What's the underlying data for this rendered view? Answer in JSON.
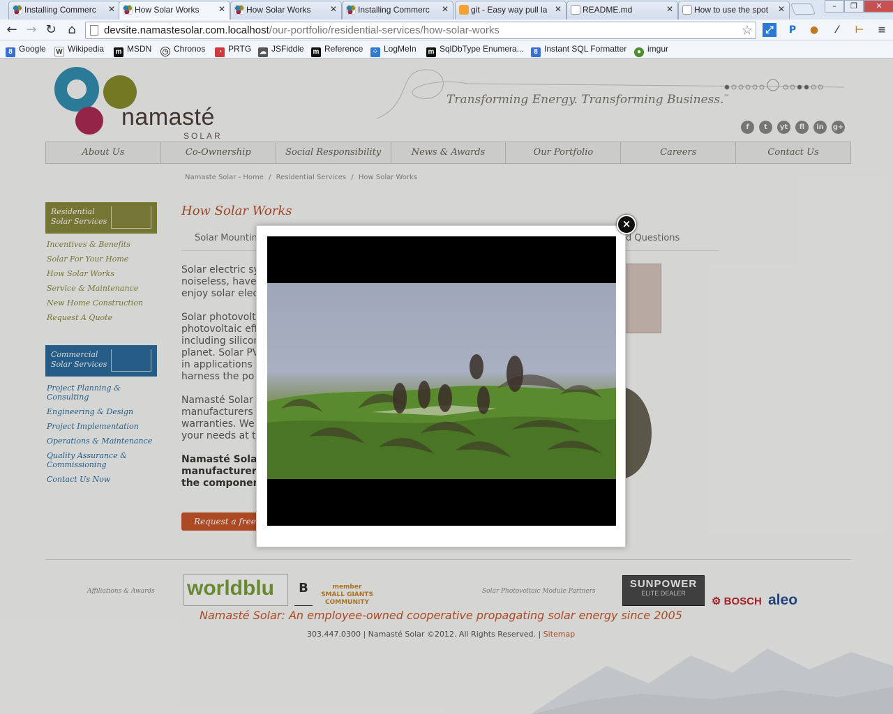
{
  "browser": {
    "tabs": [
      {
        "title": "Installing Commerc",
        "favicon": "namaste-icon",
        "active": false
      },
      {
        "title": "How Solar Works",
        "favicon": "namaste-icon",
        "active": true
      },
      {
        "title": "How Solar Works",
        "favicon": "namaste-icon",
        "active": false
      },
      {
        "title": "Installing Commerc",
        "favicon": "namaste-icon",
        "active": false
      },
      {
        "title": "git - Easy way pull la",
        "favicon": "stackoverflow-icon",
        "active": false
      },
      {
        "title": "README.md",
        "favicon": "document-icon",
        "active": false
      },
      {
        "title": "How to use the spot",
        "favicon": "document-icon",
        "active": false
      }
    ],
    "address": {
      "host": "devsite.namastesolar.com.localhost",
      "path": "/our-portfolio/residential-services/how-solar-works"
    },
    "bookmarks": [
      {
        "label": "Google",
        "icon": "google-icon",
        "color": "#3a6fd8"
      },
      {
        "label": "Wikipedia",
        "icon": "wikipedia-icon",
        "color": "#333333"
      },
      {
        "label": "MSDN",
        "icon": "msdn-icon",
        "color": "#111111"
      },
      {
        "label": "Chronos",
        "icon": "chronos-icon",
        "color": "#333333"
      },
      {
        "label": "PRTG",
        "icon": "prtg-icon",
        "color": "#d0393c"
      },
      {
        "label": "JSFiddle",
        "icon": "jsfiddle-icon",
        "color": "#555555"
      },
      {
        "label": "Reference",
        "icon": "reference-icon",
        "color": "#111111"
      },
      {
        "label": "LogMeIn",
        "icon": "logmein-icon",
        "color": "#2d7cd2"
      },
      {
        "label": "SqlDbType Enumera...",
        "icon": "msdn-icon",
        "color": "#111111"
      },
      {
        "label": "Instant SQL Formatter",
        "icon": "sqlformatter-icon",
        "color": "#3a6fd8"
      },
      {
        "label": "imgur",
        "icon": "imgur-icon",
        "color": "#4a8f2a"
      }
    ]
  },
  "site": {
    "logo": {
      "word": "namasté",
      "sub": "SOLAR"
    },
    "tagline": "Transforming Energy. Transforming Business.",
    "tagline_mark": "™",
    "social": [
      "f",
      "t",
      "yt",
      "fl",
      "in",
      "g+"
    ],
    "nav": [
      "About Us",
      "Co-Ownership",
      "Social Responsibility",
      "News & Awards",
      "Our Portfolio",
      "Careers",
      "Contact Us"
    ],
    "breadcrumbs": [
      "Namaste Solar - Home",
      "/",
      "Residential Services",
      "/",
      "How Solar Works"
    ],
    "residential": {
      "header": [
        "Residential",
        "Solar Services"
      ],
      "color": "#8a8b3c",
      "links": [
        "Incentives & Benefits",
        "Solar For Your Home",
        "How Solar Works",
        "Service & Maintenance",
        "New Home Construction",
        "Request A Quote"
      ]
    },
    "commercial": {
      "header": [
        "Commercial",
        "Solar Services"
      ],
      "color": "#2c6ea0",
      "links": [
        "Project Planning & Consulting",
        "Engineering & Design",
        "Project Implementation",
        "Operations & Maintenance",
        "Quality Assurance & Commissioning",
        "Contact Us Now"
      ]
    },
    "page_title": "How Solar Works",
    "subtabs": [
      "Solar Mountin",
      "d Questions"
    ],
    "body_lines": [
      [
        "Solar electric sy",
        "noiseless, have",
        "enjoy solar elec"
      ],
      [
        "Solar photovolt",
        "photovoltaic eff",
        "including silicon",
        "planet. Solar PV",
        "in applications r",
        "harness the po"
      ],
      [
        "Namasté Solar",
        "manufacturers",
        "warranties. We",
        "your needs at t"
      ],
      [
        "Namasté Solar",
        "manufacturers",
        "the componen"
      ]
    ],
    "cta": "Request a free q",
    "footer": {
      "affiliations_label": "Affiliations & Awards",
      "worldblu": "worldblu",
      "bcorp_label": "Certified B Corporation",
      "small_giants": "member SMALL GIANTS COMMUNITY",
      "partners_label": "Solar Photovoltaic Module Partners",
      "sunpower": "SUNPOWER",
      "sunpower_sub": "ELITE DEALER",
      "bosch": "BOSCH",
      "aleo": "aleo",
      "tagline": "Namasté Solar: An employee-owned cooperative propagating solar energy since 2005",
      "copyright": "303.447.0300 | Namasté Solar ©2012. All Rights Reserved. |",
      "sitemap": "Sitemap"
    }
  },
  "lightbox": {
    "close_glyph": "×",
    "media": "video-frame-birds-in-flight"
  }
}
